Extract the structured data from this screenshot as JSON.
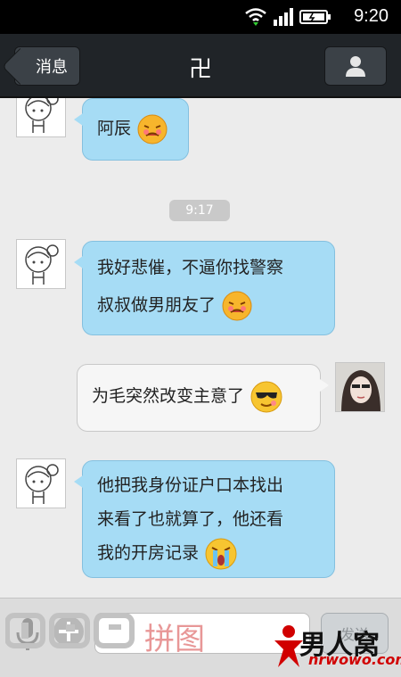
{
  "status": {
    "time": "9:20"
  },
  "header": {
    "back_label": "消息",
    "title": "卍"
  },
  "messages": [
    {
      "side": "in",
      "text": "阿辰"
    },
    {
      "side": "time",
      "text": "9:17"
    },
    {
      "side": "in",
      "lines": [
        "我好悲催，不逼你找警察",
        "叔叔做男朋友了"
      ]
    },
    {
      "side": "out",
      "text": "为毛突然改变主意了"
    },
    {
      "side": "in",
      "lines": [
        "他把我身份证户口本找出",
        "来看了也就算了，他还看",
        "我的开房记录"
      ]
    }
  ],
  "composer": {
    "send_label": "发送"
  },
  "watermarks": {
    "left_text": "拼图",
    "right_title": "男人窝",
    "right_url": "nrwowo.com"
  },
  "colors": {
    "incoming_bubble": "#a6dcf5",
    "outgoing_bubble": "#f6f6f6",
    "header_bg": "#202428",
    "chat_bg": "#ececec"
  }
}
